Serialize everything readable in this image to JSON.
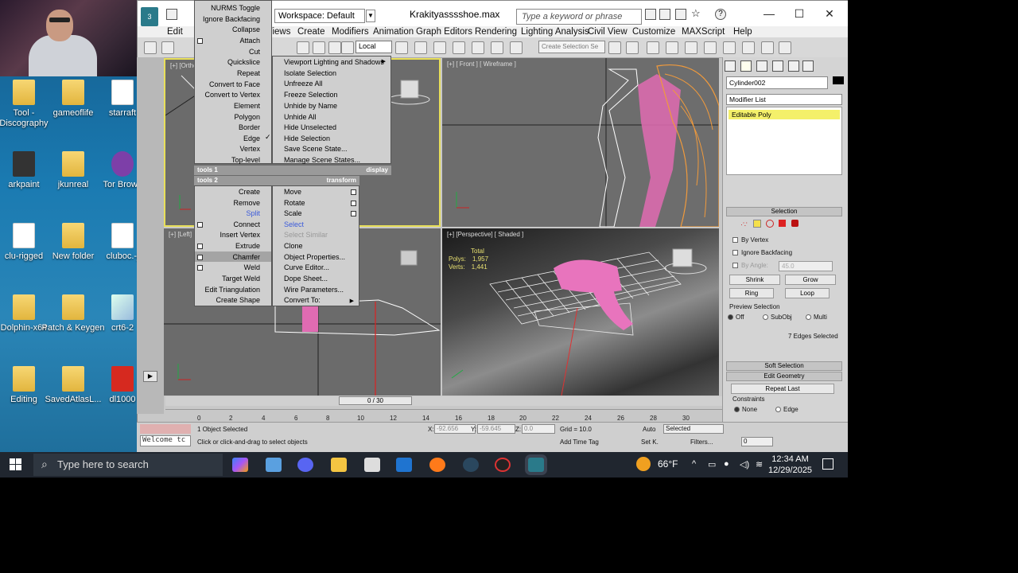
{
  "desktop": {
    "icons": [
      {
        "label": "Tool - Discography"
      },
      {
        "label": "gameoflife"
      },
      {
        "label": "starraft"
      },
      {
        "label": "arkpaint"
      },
      {
        "label": "jkunreal"
      },
      {
        "label": "Tor Brows"
      },
      {
        "label": "clu-rigged"
      },
      {
        "label": "New folder"
      },
      {
        "label": "cluboc.-j"
      },
      {
        "label": "Dolphin-x64"
      },
      {
        "label": "Patch & Keygen"
      },
      {
        "label": "crt6-2"
      },
      {
        "label": "Editing"
      },
      {
        "label": "SavedAtlasL..."
      },
      {
        "label": "dl1000"
      }
    ]
  },
  "window": {
    "title": "Krakityasssshoe.max",
    "workspace": "Workspace: Default",
    "search_placeholder": "Type a keyword or phrase",
    "minimize": "—",
    "maximize": "☐",
    "close": "✕"
  },
  "menubar": [
    "Edit",
    "Views",
    "Create",
    "Modifiers",
    "Animation",
    "Graph Editors",
    "Rendering",
    "Lighting Analysis",
    "Civil View",
    "Customize",
    "MAXScript",
    "Help"
  ],
  "toolbar": {
    "coord_system": "Local",
    "selection_set_placeholder": "Create Selection Se"
  },
  "viewports": {
    "top_left": "[+] [Ortho]",
    "top_right": "[+] [ Front ] [ Wireframe ]",
    "bottom_left": "[+] [Left]",
    "bottom_right": "[+] [Perspective] [ Shaded ]",
    "stats": {
      "total": "Total",
      "polys_label": "Polys:",
      "polys": "1,957",
      "verts_label": "Verts:",
      "verts": "1,441"
    }
  },
  "quad_menu": {
    "left_top": [
      "NURMS Toggle",
      "Ignore Backfacing",
      "Collapse",
      "Attach",
      "Cut",
      "Quickslice",
      "Repeat",
      "Convert to Face",
      "Convert to Vertex",
      "Element",
      "Polygon",
      "Border",
      "Edge",
      "Vertex",
      "Top-level"
    ],
    "right_top": [
      "Viewport Lighting and Shadows",
      "Isolate Selection",
      "Unfreeze All",
      "Freeze Selection",
      "Unhide by Name",
      "Unhide All",
      "Hide Unselected",
      "Hide Selection",
      "Save Scene State...",
      "Manage Scene States..."
    ],
    "header_tools1": "tools 1",
    "header_display": "display",
    "header_tools2": "tools 2",
    "header_transform": "transform",
    "left_bottom": [
      "Create",
      "Remove",
      "Split",
      "Connect",
      "Insert Vertex",
      "Extrude",
      "Chamfer",
      "Weld",
      "Target Weld",
      "Edit Triangulation",
      "Create Shape"
    ],
    "right_bottom": [
      "Move",
      "Rotate",
      "Scale",
      "Select",
      "Select Similar",
      "Clone",
      "Object Properties...",
      "Curve Editor...",
      "Dope Sheet...",
      "Wire Parameters...",
      "Convert To:"
    ]
  },
  "right_panel": {
    "object_name": "Cylinder002",
    "modifier_list": "Modifier List",
    "stack_item": "Editable Poly",
    "selection_header": "Selection",
    "by_vertex": "By Vertex",
    "ignore_backfacing": "Ignore Backfacing",
    "by_angle": "By Angle:",
    "angle_value": "45.0",
    "shrink": "Shrink",
    "grow": "Grow",
    "ring": "Ring",
    "loop": "Loop",
    "preview_selection": "Preview Selection",
    "preview_options": [
      "Off",
      "SubObj",
      "Multi"
    ],
    "selected_count": "7 Edges Selected",
    "soft_selection": "Soft Selection",
    "edit_geometry": "Edit Geometry",
    "repeat_last": "Repeat Last",
    "constraints": "Constraints",
    "constraint_options": [
      "None",
      "Edge"
    ]
  },
  "timeline": {
    "slider": "0 / 30",
    "ticks": [
      "0",
      "2",
      "4",
      "6",
      "8",
      "10",
      "12",
      "14",
      "16",
      "18",
      "20",
      "22",
      "24",
      "26",
      "28",
      "30"
    ]
  },
  "statusbar": {
    "selected": "1 Object Selected",
    "prompt": "Click or click-and-drag to select objects",
    "welcome": "Welcome tc",
    "x_label": "X:",
    "x_val": "-92.656",
    "y_label": "Y:",
    "y_val": "-59.645",
    "z_label": "Z:",
    "z_val": "0.0",
    "grid": "Grid = 10.0",
    "add_time_tag": "Add Time Tag",
    "auto": "Auto",
    "set_k": "Set K.",
    "selected_dd": "Selected",
    "filters": "Filters...",
    "frame": "0"
  },
  "taskbar": {
    "search": "Type here to search",
    "temperature": "66°F",
    "time": "12:34 AM",
    "date": "12/29/2025"
  }
}
